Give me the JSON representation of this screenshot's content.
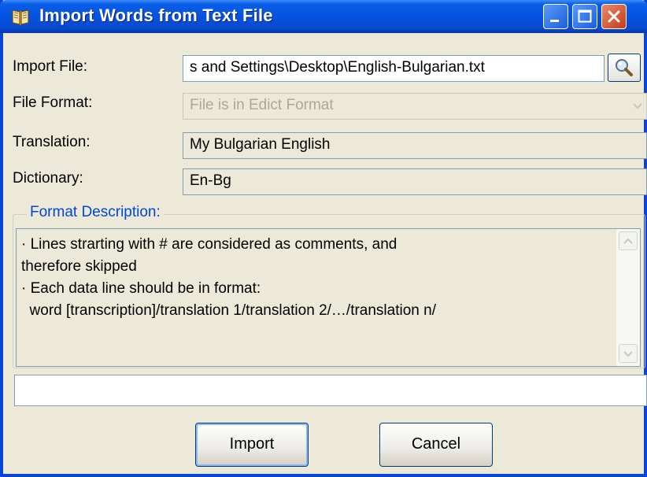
{
  "window": {
    "title": "Import Words from Text File",
    "accent": "#0a46d6"
  },
  "form": {
    "import_file": {
      "label": "Import File:",
      "value": "s and Settings\\Desktop\\English-Bulgarian.txt"
    },
    "file_format": {
      "label": "File Format:",
      "value": "File is in Edict Format",
      "disabled": true
    },
    "translation": {
      "label": "Translation:",
      "value": "My Bulgarian English"
    },
    "dictionary": {
      "label": "Dictionary:",
      "value": "En-Bg"
    }
  },
  "format_description": {
    "legend": "Format Description:",
    "lines": [
      "· Lines strarting with # are considered as comments, and",
      "therefore skipped",
      "· Each data line should be in format:",
      "  word [transcription]/translation 1/translation 2/…/translation n/"
    ]
  },
  "status_text": "",
  "buttons": {
    "import": "Import",
    "cancel": "Cancel"
  },
  "icons": {
    "title": "book-icon",
    "browse": "magnifier-icon"
  }
}
